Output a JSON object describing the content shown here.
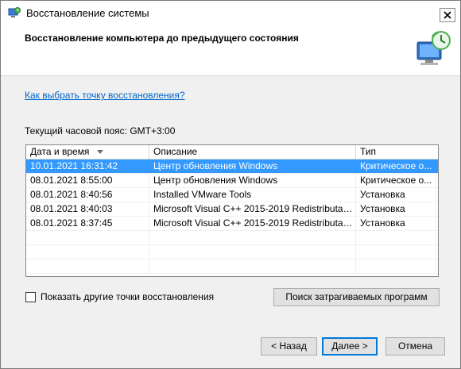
{
  "window": {
    "title": "Восстановление системы"
  },
  "header": {
    "heading": "Восстановление компьютера до предыдущего состояния"
  },
  "help_link": "Как выбрать точку восстановления?",
  "timezone": "Текущий часовой пояс: GMT+3:00",
  "table": {
    "columns": [
      "Дата и время",
      "Описание",
      "Тип"
    ],
    "rows": [
      [
        "10.01.2021 16:31:42",
        "Центр обновления Windows",
        "Критическое о..."
      ],
      [
        "08.01.2021 8:55:00",
        "Центр обновления Windows",
        "Критическое о..."
      ],
      [
        "08.01.2021 8:40:56",
        "Installed VMware Tools",
        "Установка"
      ],
      [
        "08.01.2021 8:40:03",
        "Microsoft Visual C++ 2015-2019 Redistributable ...",
        "Установка"
      ],
      [
        "08.01.2021 8:37:45",
        "Microsoft Visual C++ 2015-2019 Redistributable ...",
        "Установка"
      ]
    ],
    "selected_index": 0,
    "sort_column": "Дата и время"
  },
  "show_more_checkbox": {
    "label": "Показать другие точки восстановления",
    "checked": false
  },
  "buttons": {
    "affected": "Поиск затрагиваемых программ",
    "back": "< Назад",
    "next": "Далее >",
    "cancel": "Отмена"
  },
  "colors": {
    "selection": "#3399ff",
    "link": "#0066cc"
  }
}
